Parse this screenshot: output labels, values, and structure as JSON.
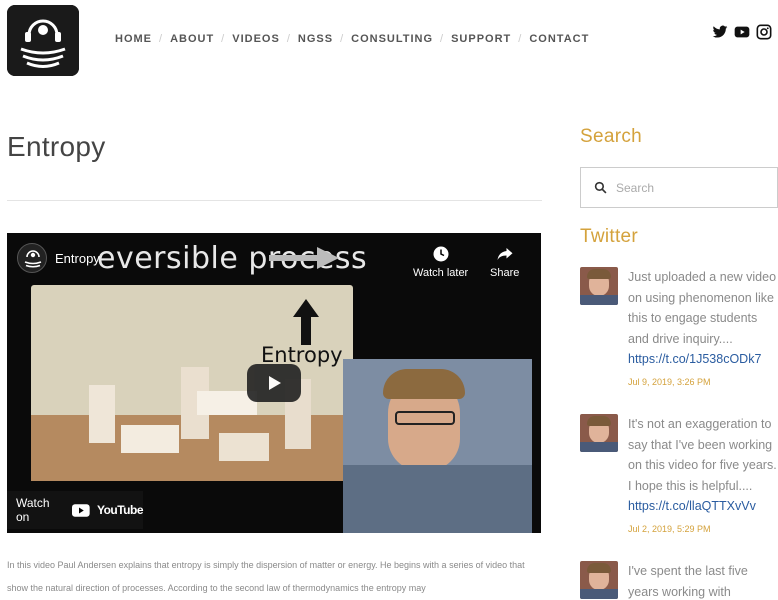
{
  "nav": {
    "items": [
      "HOME",
      "ABOUT",
      "VIDEOS",
      "NGSS",
      "CONSULTING",
      "SUPPORT",
      "CONTACT"
    ]
  },
  "social": {
    "icons": [
      "twitter-icon",
      "youtube-icon",
      "instagram-icon"
    ]
  },
  "page": {
    "title": "Entropy"
  },
  "video": {
    "title": "Entropy",
    "slide_text": "eversible process",
    "slide_label": "Entropy",
    "watch_later": "Watch later",
    "share": "Share",
    "watch_on": "Watch on",
    "youtube": "YouTube"
  },
  "description": "In this video Paul Andersen explains that entropy is simply the dispersion of matter or energy. He begins with a series of video that show the natural direction of processes. According to the second law of thermodynamics the entropy may",
  "sidebar": {
    "search_heading": "Search",
    "search_placeholder": "Search",
    "twitter_heading": "Twitter",
    "tweets": [
      {
        "text": "Just uploaded a new video on using phenomenon like this to engage students and drive inquiry....",
        "link": "https://t.co/1J538cODk7",
        "date": "Jul 9, 2019, 3:26 PM"
      },
      {
        "text": "It's not an exaggeration to say that I've been working on this video for five years. I hope this is helpful....",
        "link": "https://t.co/llaQTTXvVv",
        "date": "Jul 2, 2019, 5:29 PM"
      },
      {
        "text": "I've spent the last five years working with",
        "link": "",
        "date": ""
      }
    ]
  },
  "colors": {
    "accent": "#d4a23c",
    "link": "#2a5ca0"
  }
}
